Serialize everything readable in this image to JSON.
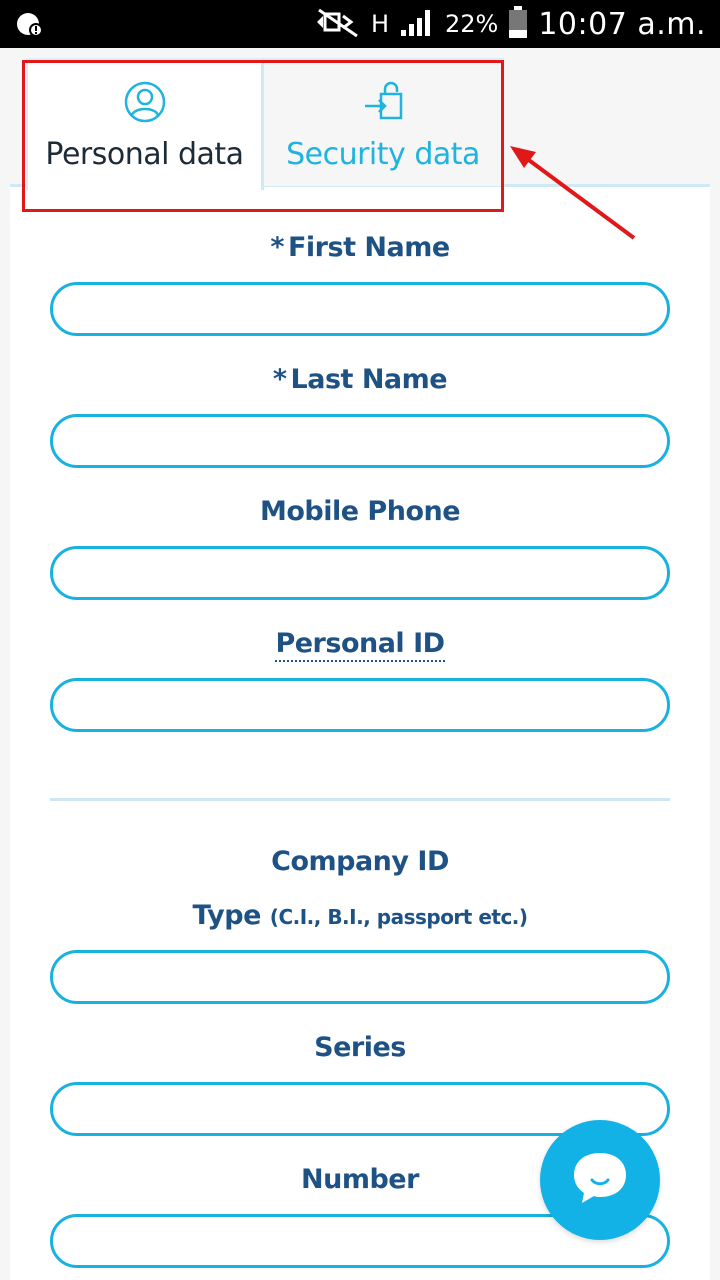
{
  "status_bar": {
    "battery_percent": "22%",
    "time": "10:07 a.m.",
    "network_type": "H"
  },
  "tabs": [
    {
      "label": "Personal data",
      "icon": "user-circle-icon",
      "active": true
    },
    {
      "label": "Security data",
      "icon": "login-lock-icon",
      "active": false
    }
  ],
  "form": {
    "first_name_label": "First Name",
    "last_name_label": "Last Name",
    "mobile_phone_label": "Mobile Phone",
    "personal_id_label": "Personal ID",
    "company_id_label": "Company ID",
    "type_label": "Type",
    "type_hint": "(C.I., B.I., passport etc.)",
    "series_label": "Series",
    "number_label": "Number",
    "required_marker": "*"
  },
  "colors": {
    "accent": "#18b1e0",
    "label": "#1f5284",
    "annotation": "#e01818"
  }
}
